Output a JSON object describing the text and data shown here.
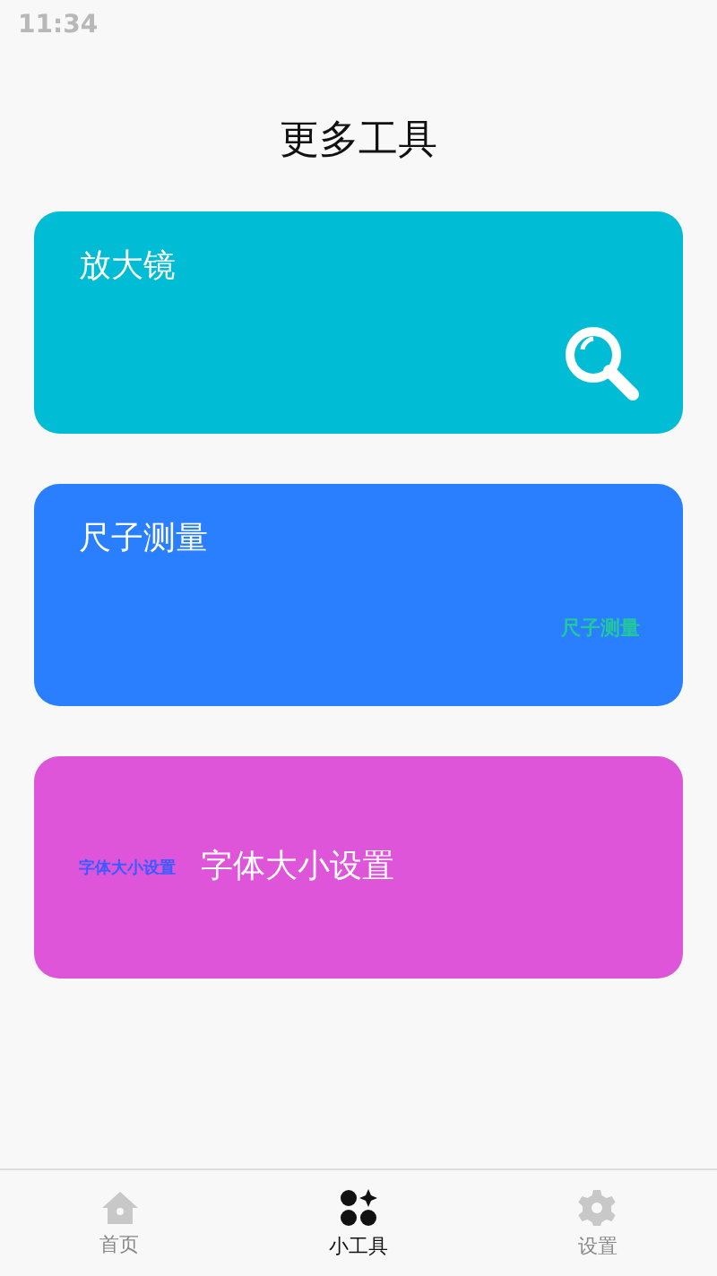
{
  "status_bar": {
    "time": "11:34"
  },
  "title": "更多工具",
  "cards": [
    {
      "kind": "icon",
      "title": "放大镜",
      "color": "#00bcd4"
    },
    {
      "kind": "caption-right",
      "title": "尺子测量",
      "caption": "尺子测量",
      "color": "#2a7fff"
    },
    {
      "kind": "caption-left",
      "title": "字体大小设置",
      "caption": "字体大小设置",
      "color": "#de55da"
    }
  ],
  "tabs": [
    {
      "kind": "home",
      "label": "首页",
      "selected": false
    },
    {
      "kind": "tools",
      "label": "小工具",
      "selected": true
    },
    {
      "kind": "settings",
      "label": "设置",
      "selected": false
    }
  ]
}
